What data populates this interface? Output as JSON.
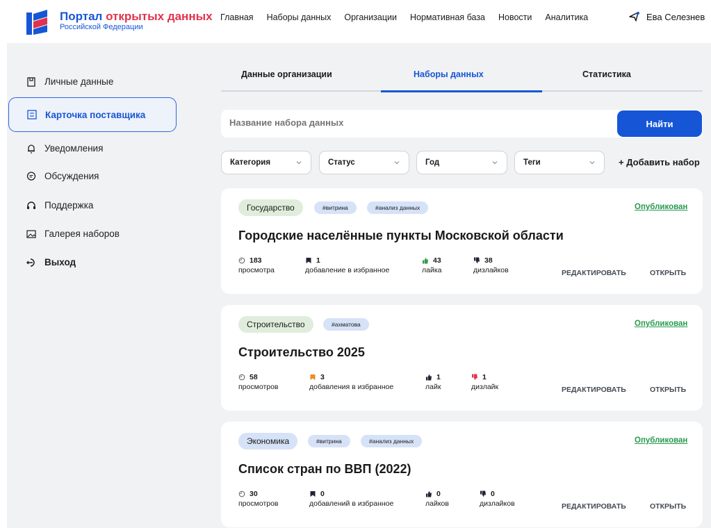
{
  "header": {
    "logo_title_part1": "Портал",
    "logo_title_part2": "открытых",
    "logo_title_part3": "данных",
    "logo_subtitle": "Российской Федерации",
    "nav": [
      "Главная",
      "Наборы данных",
      "Организации",
      "Нормативная база",
      "Новости",
      "Аналитика"
    ],
    "user_name": "Ева Селезнев"
  },
  "sidebar": {
    "items": [
      "Личные данные",
      "Карточка поставщика",
      "Уведомления",
      "Обсуждения",
      "Поддержка",
      "Галерея наборов",
      "Выход"
    ]
  },
  "tabs": [
    "Данные организации",
    "Наборы данных",
    "Статистика"
  ],
  "search": {
    "placeholder": "Название набора данных",
    "button": "Найти"
  },
  "filters": [
    "Категория",
    "Статус",
    "Год",
    "Теги"
  ],
  "add_set": "+ Добавить набор",
  "actions": {
    "edit": "РЕДАКТИРОВАТЬ",
    "open": "ОТКРЫТЬ"
  },
  "colors": {
    "accent": "#1656d6",
    "published": "#279a4e",
    "logo_red": "#e0334c"
  },
  "cards": [
    {
      "category": "Государство",
      "tags": [
        "#витрина",
        "#анализ данных"
      ],
      "status": "Опубликован",
      "title": "Городские населённые пункты Московской области",
      "views": "183",
      "views_label": "просмотра",
      "favs": "1",
      "favs_label": "добавление в избранное",
      "likes": "43",
      "likes_label": "лайка",
      "dislikes": "38",
      "dislikes_label": "дизлайков"
    },
    {
      "category": "Строительство",
      "tags": [
        "#ахматова"
      ],
      "status": "Опубликован",
      "title": "Строительство 2025",
      "views": "58",
      "views_label": "просмотров",
      "favs": "3",
      "favs_label": "добавления в избранное",
      "likes": "1",
      "likes_label": "лайк",
      "dislikes": "1",
      "dislikes_label": "дизлайк"
    },
    {
      "category": "Экономика",
      "tags": [
        "#витрина",
        "#анализ данных"
      ],
      "status": "Опубликован",
      "title": "Список стран по ВВП (2022)",
      "views": "30",
      "views_label": "просмотров",
      "favs": "0",
      "favs_label": "добавлений в избранное",
      "likes": "0",
      "likes_label": "лайков",
      "dislikes": "0",
      "dislikes_label": "дизлайков"
    }
  ]
}
